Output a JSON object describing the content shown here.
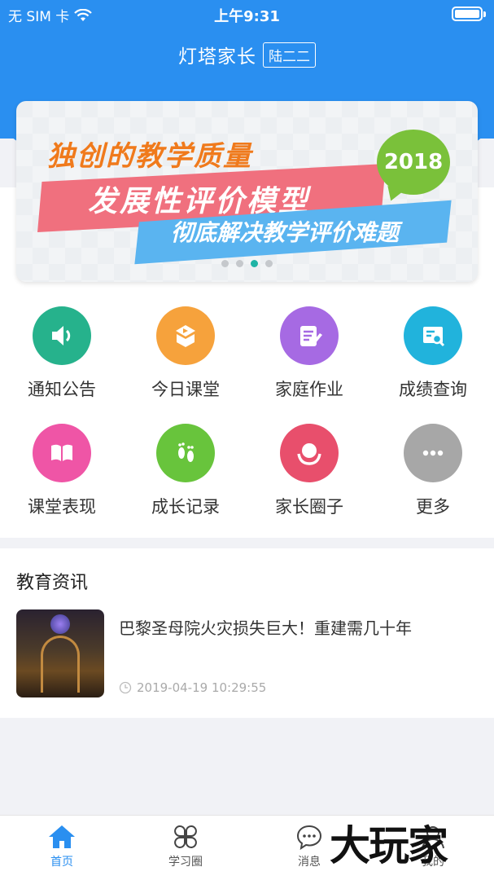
{
  "status_bar": {
    "carrier": "无 SIM 卡",
    "time": "上午9:31"
  },
  "header": {
    "title": "灯塔家长",
    "class_name": "陆二二"
  },
  "banner": {
    "line1": "独创的教学质量",
    "line2": "发展性评价模型",
    "line3": "彻底解决教学评价难题",
    "badge": "2018",
    "pages": 4,
    "active_page": 3
  },
  "grid": [
    {
      "label": "通知公告",
      "icon": "speaker-icon",
      "color": "#26b28c"
    },
    {
      "label": "今日课堂",
      "icon": "class-video-icon",
      "color": "#f6a23c"
    },
    {
      "label": "家庭作业",
      "icon": "homework-icon",
      "color": "#a66ae3"
    },
    {
      "label": "成绩查询",
      "icon": "grade-search-icon",
      "color": "#21b3dc"
    },
    {
      "label": "课堂表现",
      "icon": "book-icon",
      "color": "#ef55a6"
    },
    {
      "label": "成长记录",
      "icon": "footprint-icon",
      "color": "#68c43c"
    },
    {
      "label": "家长圈子",
      "icon": "parent-circle-icon",
      "color": "#e84f6c"
    },
    {
      "label": "更多",
      "icon": "more-icon",
      "color": "#a7a7a7"
    }
  ],
  "news": {
    "heading": "教育资讯",
    "items": [
      {
        "title": "巴黎圣母院火灾损失巨大！重建需几十年",
        "time": "2019-04-19 10:29:55"
      }
    ]
  },
  "tabbar": [
    {
      "label": "首页",
      "icon": "home-icon",
      "active": true
    },
    {
      "label": "学习圈",
      "icon": "clover-icon",
      "active": false
    },
    {
      "label": "消息",
      "icon": "message-icon",
      "active": false
    },
    {
      "label": "我的",
      "icon": "profile-icon",
      "active": false
    }
  ],
  "watermark": "大玩家"
}
